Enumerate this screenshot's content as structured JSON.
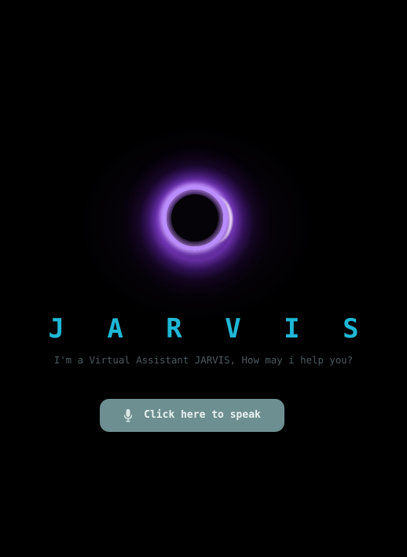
{
  "assistant": {
    "title": "J A R V I S",
    "greeting": "I'm a Virtual Assistant JARVIS, How may i help you?"
  },
  "speak_button": {
    "label": "Click here to speak",
    "icon": "microphone-icon"
  },
  "colors": {
    "background": "#000000",
    "title": "#1fb7d6",
    "subtitle": "#4c5a5e",
    "button_bg": "#6e8f91",
    "button_text": "#e9f2f2",
    "orb_ring": "#b98cff"
  }
}
